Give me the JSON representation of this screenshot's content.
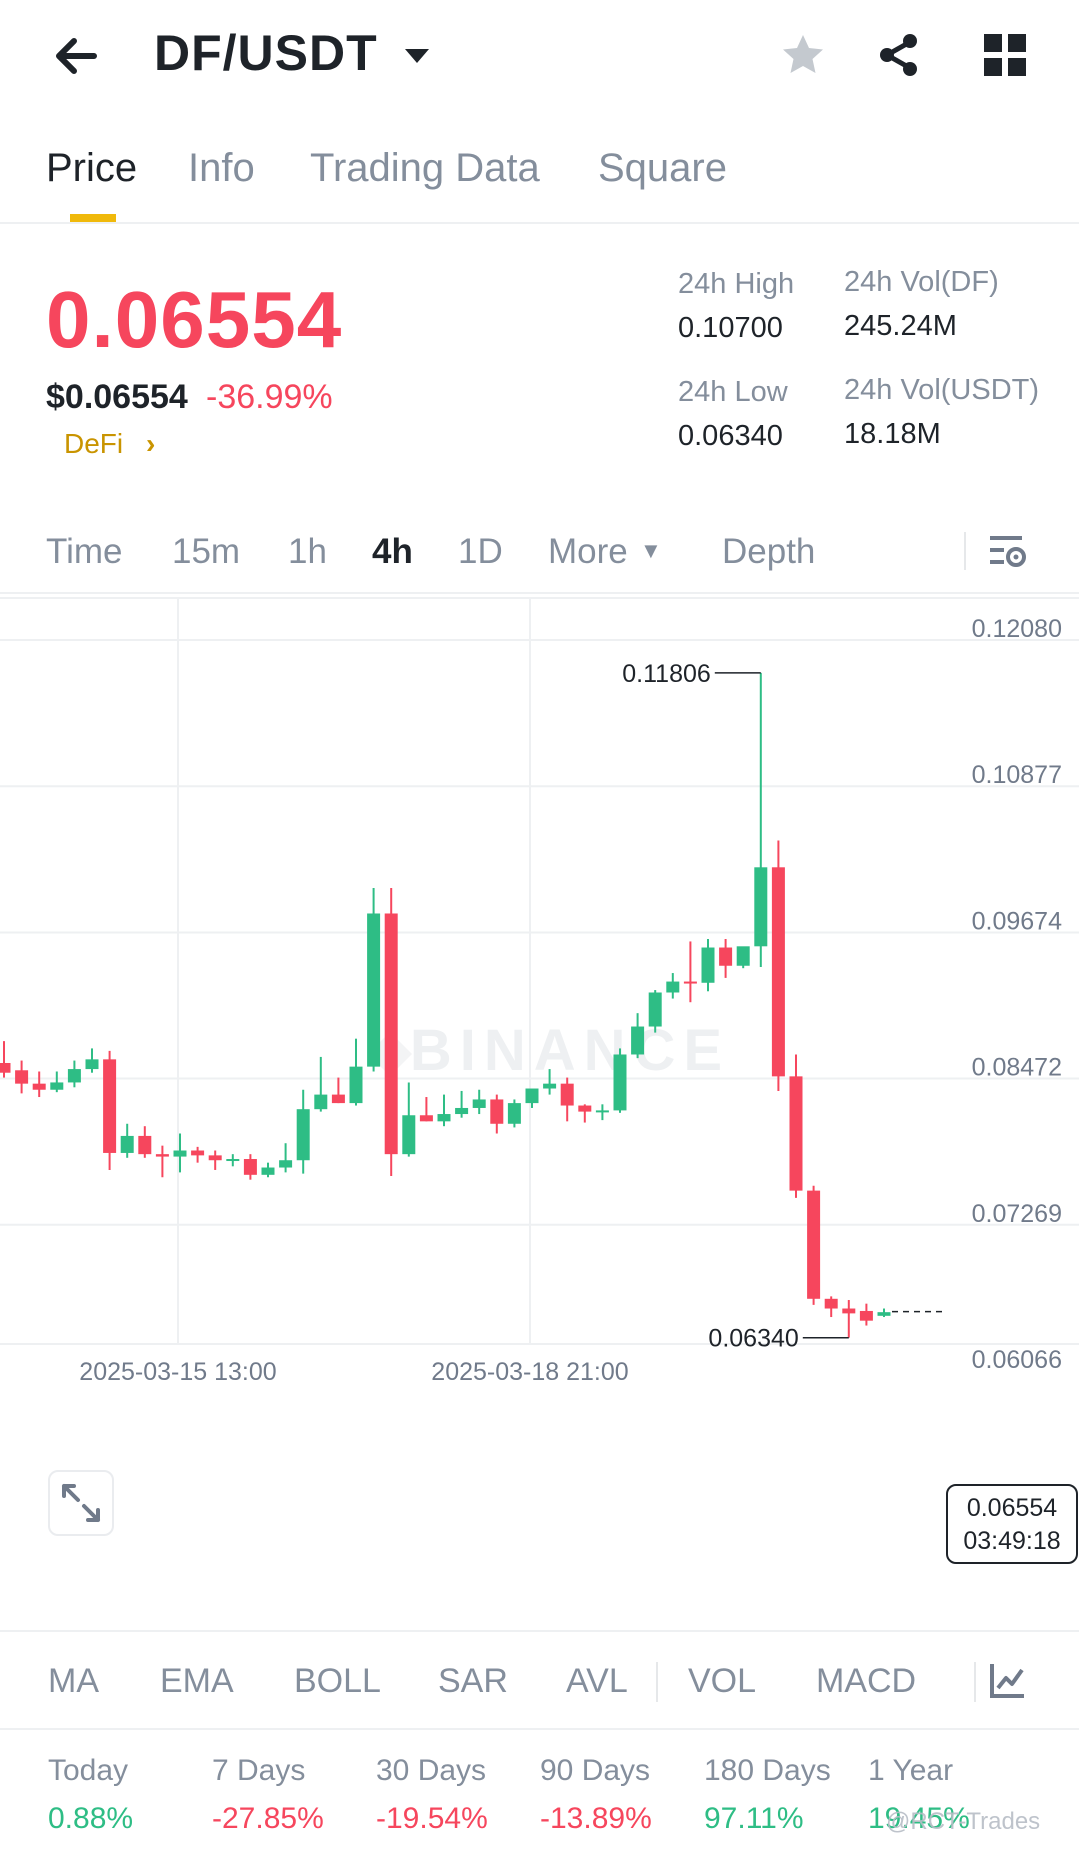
{
  "header": {
    "pair": "DF/USDT",
    "back_icon": "arrow-left-icon",
    "caret_icon": "caret-down-icon",
    "star_icon": "star-icon",
    "share_icon": "share-icon",
    "grid_icon": "grid-icon"
  },
  "tabs": [
    {
      "label": "Price",
      "active": true
    },
    {
      "label": "Info",
      "active": false
    },
    {
      "label": "Trading Data",
      "active": false
    },
    {
      "label": "Square",
      "active": false
    }
  ],
  "ticker": {
    "last_price": "0.06554",
    "usd_price": "$0.06554",
    "change": "-36.99%",
    "tag": "DeFi",
    "tag_arrow": "›",
    "high_label": "24h High",
    "high_value": "0.10700",
    "low_label": "24h Low",
    "low_value": "0.06340",
    "vol_df_label": "24h Vol(DF)",
    "vol_df_value": "245.24M",
    "vol_usdt_label": "24h Vol(USDT)",
    "vol_usdt_value": "18.18M"
  },
  "timebar": {
    "items": [
      {
        "label": "Time",
        "active": false
      },
      {
        "label": "15m",
        "active": false
      },
      {
        "label": "1h",
        "active": false
      },
      {
        "label": "4h",
        "active": true
      },
      {
        "label": "1D",
        "active": false
      },
      {
        "label": "More",
        "active": false
      },
      {
        "label": "Depth",
        "active": false
      }
    ],
    "more_caret": "▼",
    "settings_icon": "chart-settings-icon"
  },
  "chart_data": {
    "type": "candlestick",
    "interval": "4h",
    "watermark": "BINANCE",
    "y_ticks": [
      "0.12080",
      "0.10877",
      "0.09674",
      "0.08472",
      "0.07269",
      "0.06066"
    ],
    "y_tick_values": [
      0.1208,
      0.10877,
      0.09674,
      0.08472,
      0.07269,
      0.06066
    ],
    "x_ticks": [
      "2025-03-15 13:00",
      "2025-03-18 21:00"
    ],
    "high_marker": "0.11806",
    "low_marker": "0.06340",
    "last_price": "0.06554",
    "countdown": "03:49:18",
    "colors": {
      "up": "#2ebd85",
      "down": "#f6465d",
      "grid": "#eef0f2",
      "axis_text": "#707a8a"
    },
    "candles": [
      {
        "o": 0.086,
        "h": 0.0878,
        "l": 0.0848,
        "c": 0.0852
      },
      {
        "o": 0.0854,
        "h": 0.0862,
        "l": 0.0835,
        "c": 0.0843
      },
      {
        "o": 0.0843,
        "h": 0.0853,
        "l": 0.0832,
        "c": 0.0838
      },
      {
        "o": 0.0838,
        "h": 0.0853,
        "l": 0.0836,
        "c": 0.0844
      },
      {
        "o": 0.0844,
        "h": 0.0862,
        "l": 0.084,
        "c": 0.0855
      },
      {
        "o": 0.0855,
        "h": 0.0872,
        "l": 0.0852,
        "c": 0.0863
      },
      {
        "o": 0.0863,
        "h": 0.087,
        "l": 0.0772,
        "c": 0.0786
      },
      {
        "o": 0.0786,
        "h": 0.081,
        "l": 0.0782,
        "c": 0.08
      },
      {
        "o": 0.08,
        "h": 0.0808,
        "l": 0.0782,
        "c": 0.0785
      },
      {
        "o": 0.0785,
        "h": 0.0792,
        "l": 0.0766,
        "c": 0.0783
      },
      {
        "o": 0.0783,
        "h": 0.0802,
        "l": 0.077,
        "c": 0.0788
      },
      {
        "o": 0.0788,
        "h": 0.0791,
        "l": 0.0778,
        "c": 0.0784
      },
      {
        "o": 0.0784,
        "h": 0.0788,
        "l": 0.0772,
        "c": 0.078
      },
      {
        "o": 0.078,
        "h": 0.0785,
        "l": 0.0775,
        "c": 0.0781
      },
      {
        "o": 0.0781,
        "h": 0.0785,
        "l": 0.0764,
        "c": 0.0768
      },
      {
        "o": 0.0768,
        "h": 0.0778,
        "l": 0.0766,
        "c": 0.0774
      },
      {
        "o": 0.0774,
        "h": 0.0794,
        "l": 0.077,
        "c": 0.078
      },
      {
        "o": 0.078,
        "h": 0.0838,
        "l": 0.0769,
        "c": 0.0822
      },
      {
        "o": 0.0822,
        "h": 0.0865,
        "l": 0.082,
        "c": 0.0834
      },
      {
        "o": 0.0834,
        "h": 0.0848,
        "l": 0.0827,
        "c": 0.0827
      },
      {
        "o": 0.0827,
        "h": 0.088,
        "l": 0.0825,
        "c": 0.0857
      },
      {
        "o": 0.0857,
        "h": 0.1004,
        "l": 0.0853,
        "c": 0.0983
      },
      {
        "o": 0.0983,
        "h": 0.1004,
        "l": 0.0767,
        "c": 0.0785
      },
      {
        "o": 0.0785,
        "h": 0.0844,
        "l": 0.0783,
        "c": 0.0817
      },
      {
        "o": 0.0817,
        "h": 0.0832,
        "l": 0.0812,
        "c": 0.0812
      },
      {
        "o": 0.0812,
        "h": 0.0834,
        "l": 0.0808,
        "c": 0.0818
      },
      {
        "o": 0.0818,
        "h": 0.0837,
        "l": 0.0815,
        "c": 0.0823
      },
      {
        "o": 0.0823,
        "h": 0.0838,
        "l": 0.0818,
        "c": 0.083
      },
      {
        "o": 0.083,
        "h": 0.0834,
        "l": 0.0802,
        "c": 0.081
      },
      {
        "o": 0.081,
        "h": 0.083,
        "l": 0.0807,
        "c": 0.0827
      },
      {
        "o": 0.0827,
        "h": 0.0838,
        "l": 0.0823,
        "c": 0.0839
      },
      {
        "o": 0.0839,
        "h": 0.0855,
        "l": 0.0834,
        "c": 0.0843
      },
      {
        "o": 0.0843,
        "h": 0.0848,
        "l": 0.0812,
        "c": 0.0825
      },
      {
        "o": 0.0825,
        "h": 0.0826,
        "l": 0.0811,
        "c": 0.082
      },
      {
        "o": 0.082,
        "h": 0.0826,
        "l": 0.0813,
        "c": 0.0821
      },
      {
        "o": 0.0821,
        "h": 0.0872,
        "l": 0.0819,
        "c": 0.0867
      },
      {
        "o": 0.0867,
        "h": 0.0901,
        "l": 0.0864,
        "c": 0.089
      },
      {
        "o": 0.089,
        "h": 0.092,
        "l": 0.0885,
        "c": 0.0918
      },
      {
        "o": 0.0918,
        "h": 0.0934,
        "l": 0.0913,
        "c": 0.0927
      },
      {
        "o": 0.0927,
        "h": 0.096,
        "l": 0.091,
        "c": 0.0926
      },
      {
        "o": 0.0926,
        "h": 0.0962,
        "l": 0.0919,
        "c": 0.0955
      },
      {
        "o": 0.0955,
        "h": 0.0962,
        "l": 0.093,
        "c": 0.094
      },
      {
        "o": 0.094,
        "h": 0.0955,
        "l": 0.0938,
        "c": 0.0956
      },
      {
        "o": 0.0956,
        "h": 0.1181,
        "l": 0.0939,
        "c": 0.1021
      },
      {
        "o": 0.1021,
        "h": 0.1043,
        "l": 0.0837,
        "c": 0.0849
      },
      {
        "o": 0.0849,
        "h": 0.0867,
        "l": 0.0749,
        "c": 0.0755
      },
      {
        "o": 0.0755,
        "h": 0.0759,
        "l": 0.0661,
        "c": 0.0666
      },
      {
        "o": 0.0666,
        "h": 0.0668,
        "l": 0.0651,
        "c": 0.0658
      },
      {
        "o": 0.0658,
        "h": 0.0665,
        "l": 0.0634,
        "c": 0.0654
      },
      {
        "o": 0.0656,
        "h": 0.0662,
        "l": 0.0644,
        "c": 0.0648
      },
      {
        "o": 0.0652,
        "h": 0.0658,
        "l": 0.0651,
        "c": 0.0655
      }
    ]
  },
  "indicators": {
    "items": [
      "MA",
      "EMA",
      "BOLL",
      "SAR",
      "AVL",
      "VOL",
      "MACD"
    ],
    "chart_icon": "indicator-chart-icon"
  },
  "performance": [
    {
      "label": "Today",
      "value": "0.88%",
      "positive": true
    },
    {
      "label": "7 Days",
      "value": "-27.85%",
      "positive": false
    },
    {
      "label": "30 Days",
      "value": "-19.54%",
      "positive": false
    },
    {
      "label": "90 Days",
      "value": "-13.89%",
      "positive": false
    },
    {
      "label": "180 Days",
      "value": "97.11%",
      "positive": true
    },
    {
      "label": "1 Year",
      "value": "19.45%",
      "positive": true
    }
  ],
  "watermark_text": "@RCT-Trades"
}
